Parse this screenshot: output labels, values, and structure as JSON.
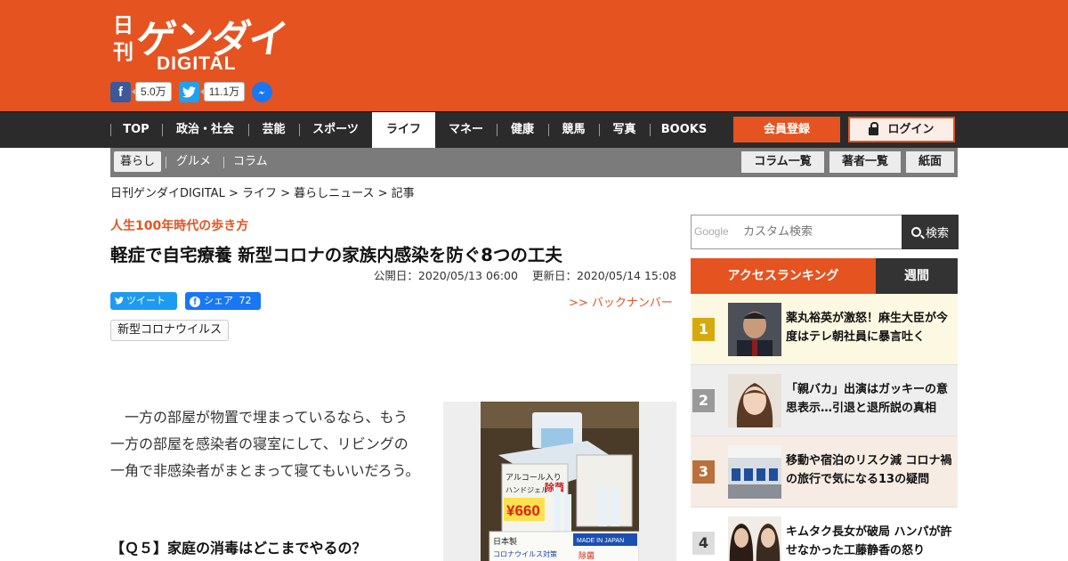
{
  "header": {
    "logo_kanji": "日刊",
    "logo_main": "ゲンダイ",
    "logo_sub": "DIGITAL",
    "facebook_count": "5.0万",
    "twitter_count": "11.1万"
  },
  "nav": {
    "items": [
      "TOP",
      "政治・社会",
      "芸能",
      "スポーツ",
      "ライフ",
      "マネー",
      "健康",
      "競馬",
      "写真",
      "BOOKS"
    ],
    "active": "ライフ",
    "member_button": "会員登録",
    "login_button": "ログイン"
  },
  "subnav": {
    "items": [
      "暮らし",
      "グルメ",
      "コラム"
    ],
    "active": "暮らし",
    "buttons": [
      "コラム一覧",
      "著者一覧",
      "紙面"
    ]
  },
  "breadcrumb": "日刊ゲンダイDIGITAL > ライフ > 暮らしニュース > 記事",
  "article": {
    "kicker": "人生100年時代の歩き方",
    "title": "軽症で自宅療養 新型コロナの家族内感染を防ぐ8つの工夫",
    "published": "公開日：2020/05/13 06:00",
    "updated": "更新日：2020/05/14 15:08",
    "tweet_label": "ツイート",
    "share_label": "シェア",
    "share_count": "72",
    "back_number": ">> バックナンバー",
    "tag": "新型コロナウイルス",
    "body": "一方の部屋が物置で埋まっているなら、もう一方の部屋を感染者の寝室にして、リビングの一角で非感染者がまとまって寝てもいいだろう。",
    "question": "【Ｑ５】家庭の消毒はどこまでやるの？"
  },
  "photo_text": {
    "sign1": "アルコール入り",
    "sign2": "除菌",
    "sign3": "ハンドジェル",
    "price": "¥660",
    "sign4": "日本製",
    "sign5": "コロナウイルス対策",
    "sign6": "MADE IN JAPAN",
    "sign7": "除菌"
  },
  "sidebar": {
    "search_brand": "Google",
    "search_placeholder": "カスタム検索",
    "search_button": "検索",
    "ranking_title": "アクセスランキング",
    "ranking_tab": "週間",
    "ranking": [
      {
        "rank": "1",
        "text": "薬丸裕英が激怒！麻生大臣が今度はテレ朝社員に暴言吐く",
        "color": "#d6a90e",
        "bg": "#fdf8e1"
      },
      {
        "rank": "2",
        "text": "「親バカ」出演はガッキーの意思表示…引退と退所説の真相",
        "color": "#999999",
        "bg": "#eeeeee"
      },
      {
        "rank": "3",
        "text": "移動や宿泊のリスク減 コロナ禍の旅行で気になる13の疑問",
        "color": "#b8713a",
        "bg": "#f6ece3"
      },
      {
        "rank": "4",
        "text": "キムタク長女が破局 ハンパが許せなかった工藤静香の怒り",
        "color": "#dddddd",
        "bg": "#ffffff"
      }
    ]
  }
}
